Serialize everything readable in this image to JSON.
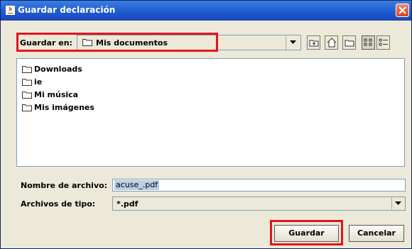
{
  "dialog": {
    "title": "Guardar declaración"
  },
  "look_in": {
    "label": "Guardar en:",
    "selected": "Mis documentos"
  },
  "toolbar": {
    "icons": [
      "up-folder-icon",
      "home-icon",
      "new-folder-icon",
      "list-view-icon",
      "details-view-icon"
    ]
  },
  "files": [
    {
      "name": "Downloads"
    },
    {
      "name": "ie"
    },
    {
      "name": "Mi música"
    },
    {
      "name": "Mis imágenes"
    }
  ],
  "filename": {
    "label": "Nombre de archivo:",
    "value": "acuse_.pdf"
  },
  "filetype": {
    "label": "Archivos de tipo:",
    "selected": "*.pdf"
  },
  "buttons": {
    "save": "Guardar",
    "cancel": "Cancelar"
  },
  "colors": {
    "titlebar": "#1f5bd0",
    "highlight_box": "#e4141c",
    "background": "#ece9d8"
  }
}
